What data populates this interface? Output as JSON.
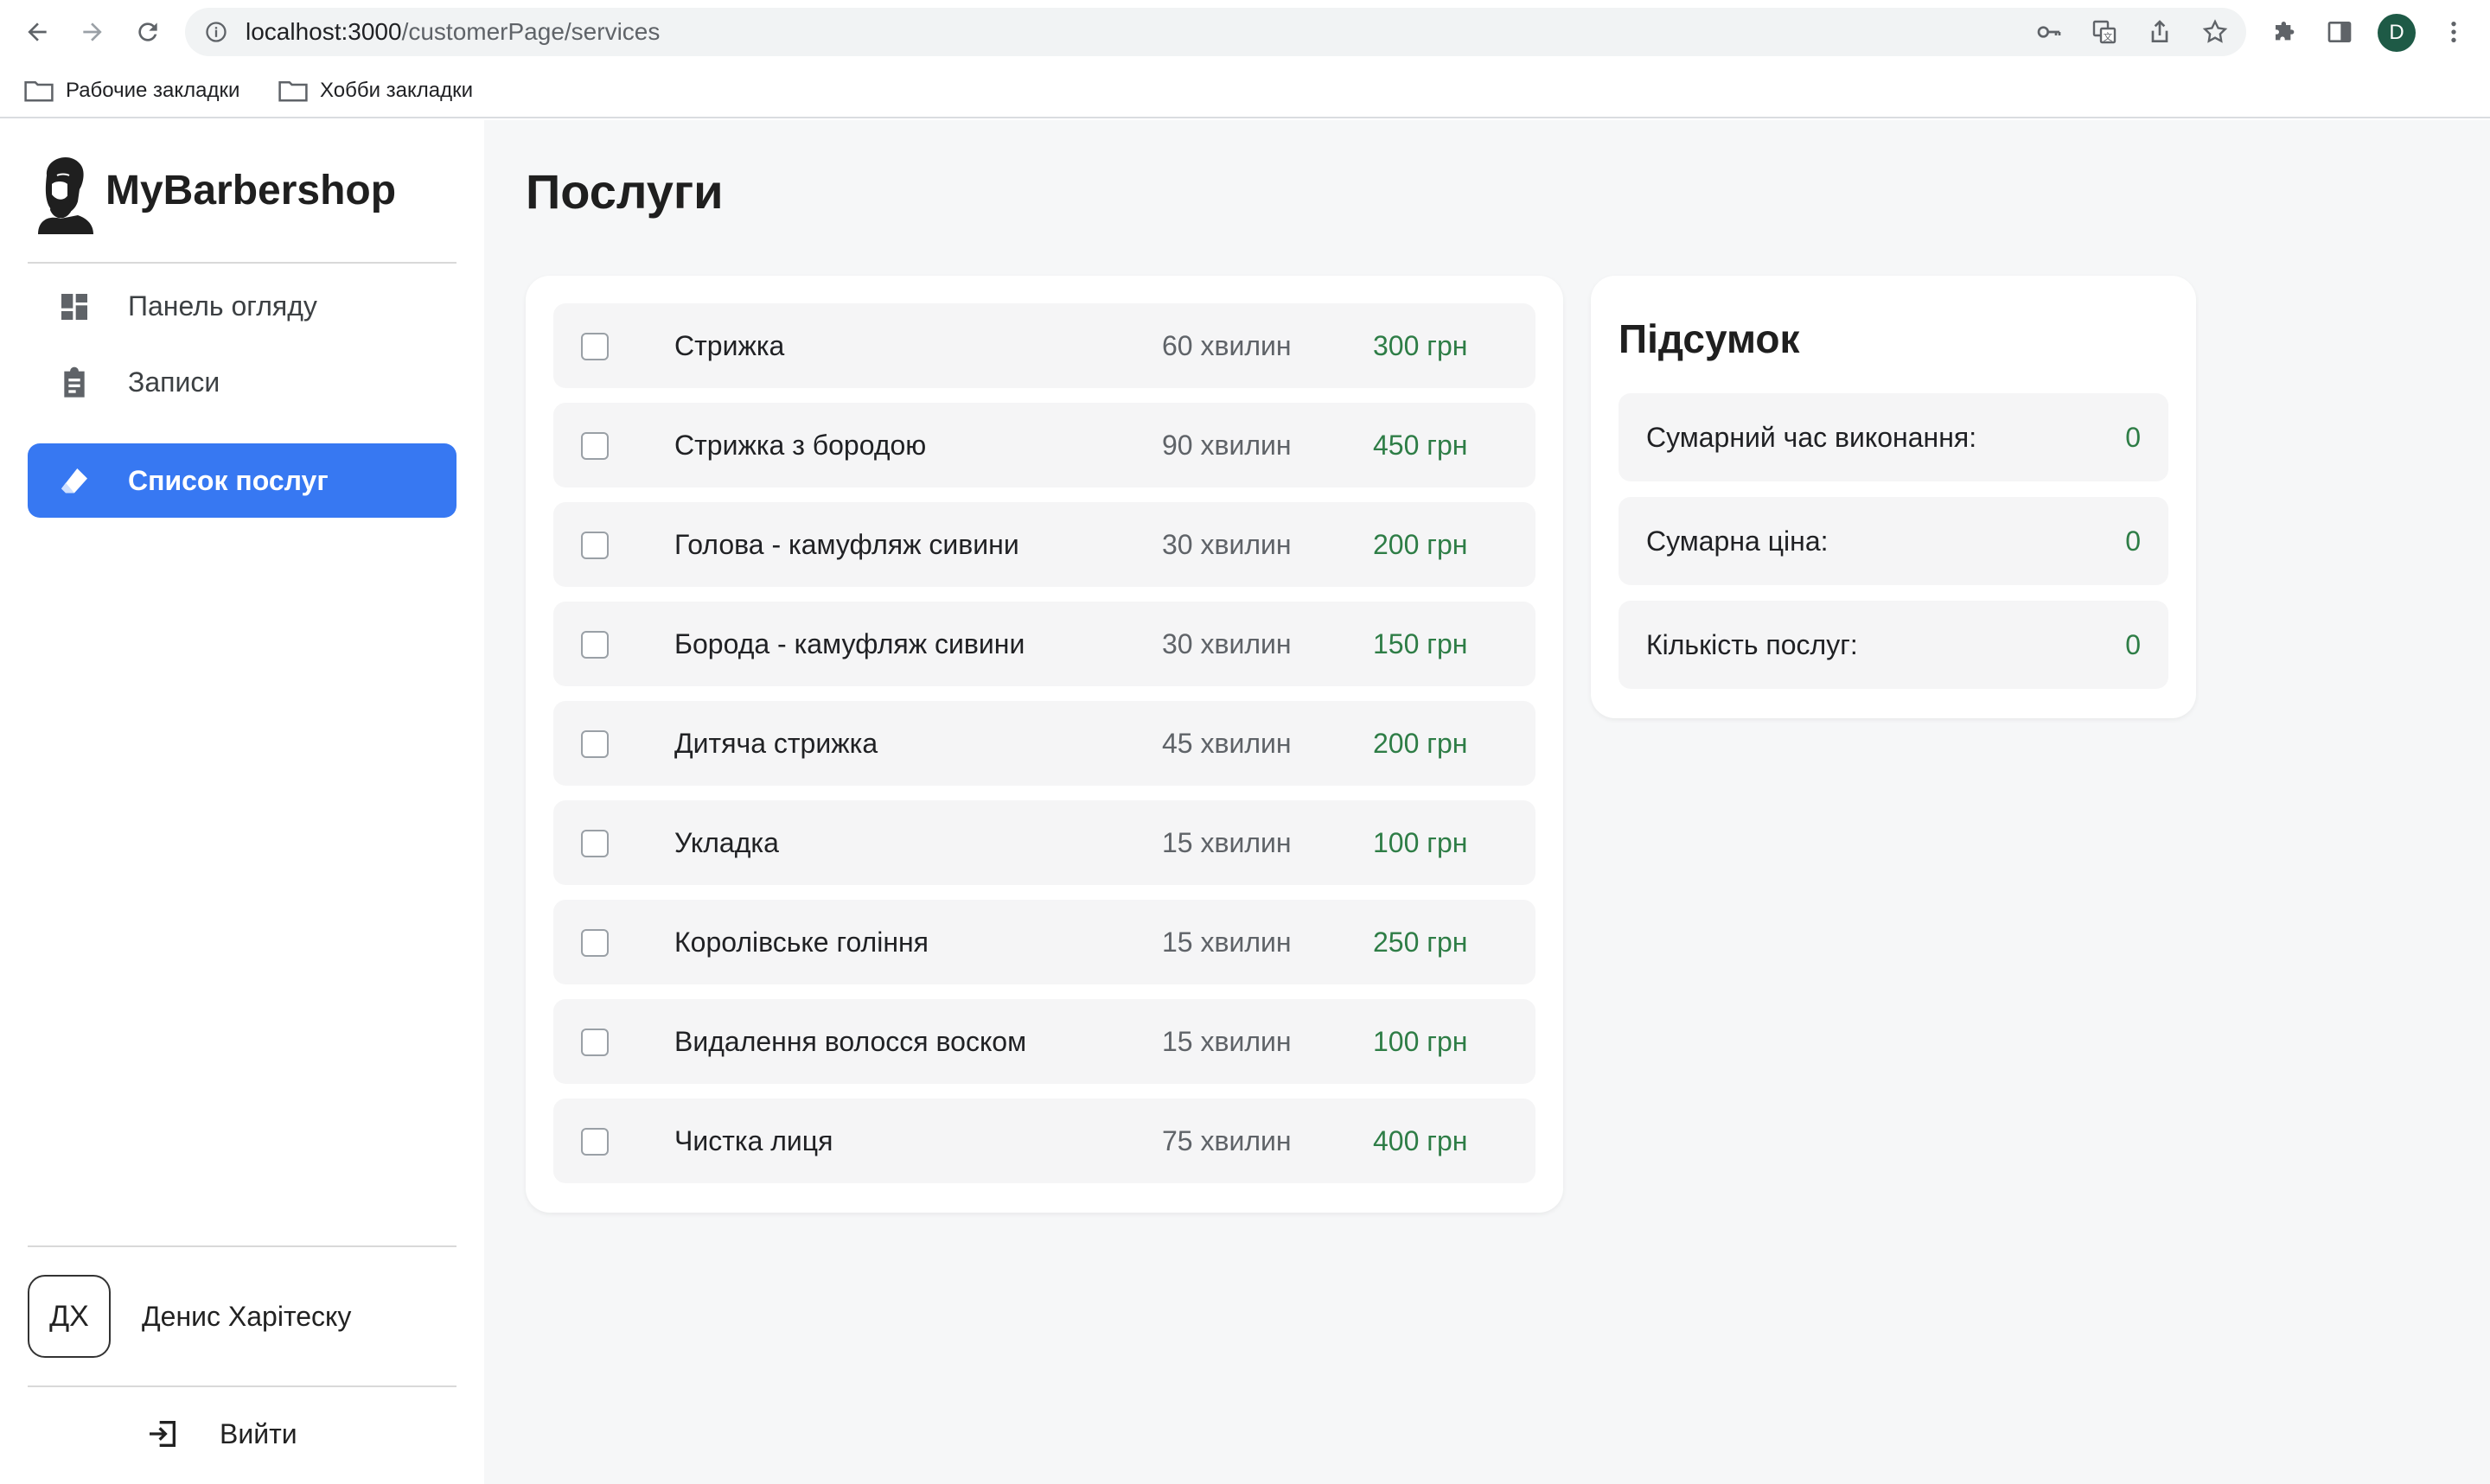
{
  "browser": {
    "url_host": "localhost:3000",
    "url_path": "/customerPage/services",
    "profile_initial": "D",
    "bookmarks": [
      {
        "label": "Рабочие закладки",
        "icon": "folder-icon"
      },
      {
        "label": "Хобби закладки",
        "icon": "folder-icon"
      }
    ]
  },
  "sidebar": {
    "brand": "MyBarbershop",
    "items": [
      {
        "label": "Панель огляду",
        "icon": "dashboard-icon",
        "active": false
      },
      {
        "label": "Записи",
        "icon": "clipboard-icon",
        "active": false
      },
      {
        "label": "Список послуг",
        "icon": "eraser-icon",
        "active": true
      }
    ],
    "user": {
      "initials": "ДХ",
      "name": "Денис Харітеску"
    },
    "logout_label": "Вийти"
  },
  "main": {
    "title": "Послуги",
    "services": [
      {
        "name": "Стрижка",
        "duration": "60 хвилин",
        "price": "300 грн",
        "checked": false
      },
      {
        "name": "Стрижка з бородою",
        "duration": "90 хвилин",
        "price": "450 грн",
        "checked": false
      },
      {
        "name": "Голова - камуфляж сивини",
        "duration": "30 хвилин",
        "price": "200 грн",
        "checked": false
      },
      {
        "name": "Борода - камуфляж сивини",
        "duration": "30 хвилин",
        "price": "150 грн",
        "checked": false
      },
      {
        "name": "Дитяча стрижка",
        "duration": "45 хвилин",
        "price": "200 грн",
        "checked": false
      },
      {
        "name": "Укладка",
        "duration": "15 хвилин",
        "price": "100 грн",
        "checked": false
      },
      {
        "name": "Королівське гоління",
        "duration": "15 хвилин",
        "price": "250 грн",
        "checked": false
      },
      {
        "name": "Видалення волосся воском",
        "duration": "15 хвилин",
        "price": "100 грн",
        "checked": false
      },
      {
        "name": "Чистка лиця",
        "duration": "75 хвилин",
        "price": "400 грн",
        "checked": false
      }
    ],
    "summary": {
      "title": "Підсумок",
      "rows": [
        {
          "label": "Сумарний час виконання:",
          "value": "0"
        },
        {
          "label": "Сумарна ціна:",
          "value": "0"
        },
        {
          "label": "Кількість послуг:",
          "value": "0"
        }
      ]
    }
  },
  "colors": {
    "accent": "#3778f2",
    "price": "#2e7d46",
    "background": "#f6f7f8"
  }
}
